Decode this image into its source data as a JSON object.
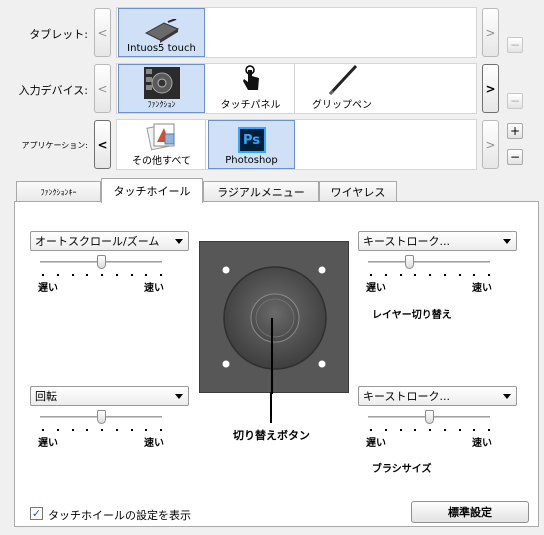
{
  "rows": {
    "tablet": {
      "label": "タブレット:",
      "tiles": [
        "Intuos5 touch"
      ]
    },
    "input_device": {
      "label": "入力デバイス:",
      "tiles": [
        "ﾌｧﾝｸｼｮﾝ",
        "タッチパネル",
        "グリップペン"
      ]
    },
    "application": {
      "label": "アプリケーション:",
      "tiles": [
        "その他すべて",
        "Photoshop"
      ]
    }
  },
  "nav": {
    "prev": "<",
    "next": ">",
    "add": "+",
    "remove": "−"
  },
  "app_icon_text": "Ps",
  "tabs": [
    "ﾌｧﾝｸｼｮﾝｷｰ",
    "タッチホイール",
    "ラジアルメニュー",
    "ワイヤレス"
  ],
  "panel": {
    "top_left": {
      "select": "オートスクロール/ズーム",
      "slow": "遅い",
      "fast": "速い",
      "speed": 0.5
    },
    "bottom_left": {
      "select": "回転",
      "slow": "遅い",
      "fast": "速い",
      "speed": 0.5
    },
    "top_right": {
      "select": "キーストローク...",
      "slow": "遅い",
      "fast": "速い",
      "speed": 0.33,
      "caption": "レイヤー切り替え"
    },
    "bottom_right": {
      "select": "キーストローク...",
      "slow": "遅い",
      "fast": "速い",
      "speed": 0.5,
      "caption": "ブラシサイズ"
    },
    "center_caption": "切り替えボタン",
    "show_settings_checkbox": {
      "label": "タッチホイールの設定を表示",
      "checked": true
    },
    "defaults_button": "標準設定"
  },
  "colors": {
    "selected_tile": "#cfe0f7",
    "ps_blue": "#001e36",
    "ps_text": "#31a8ff"
  }
}
